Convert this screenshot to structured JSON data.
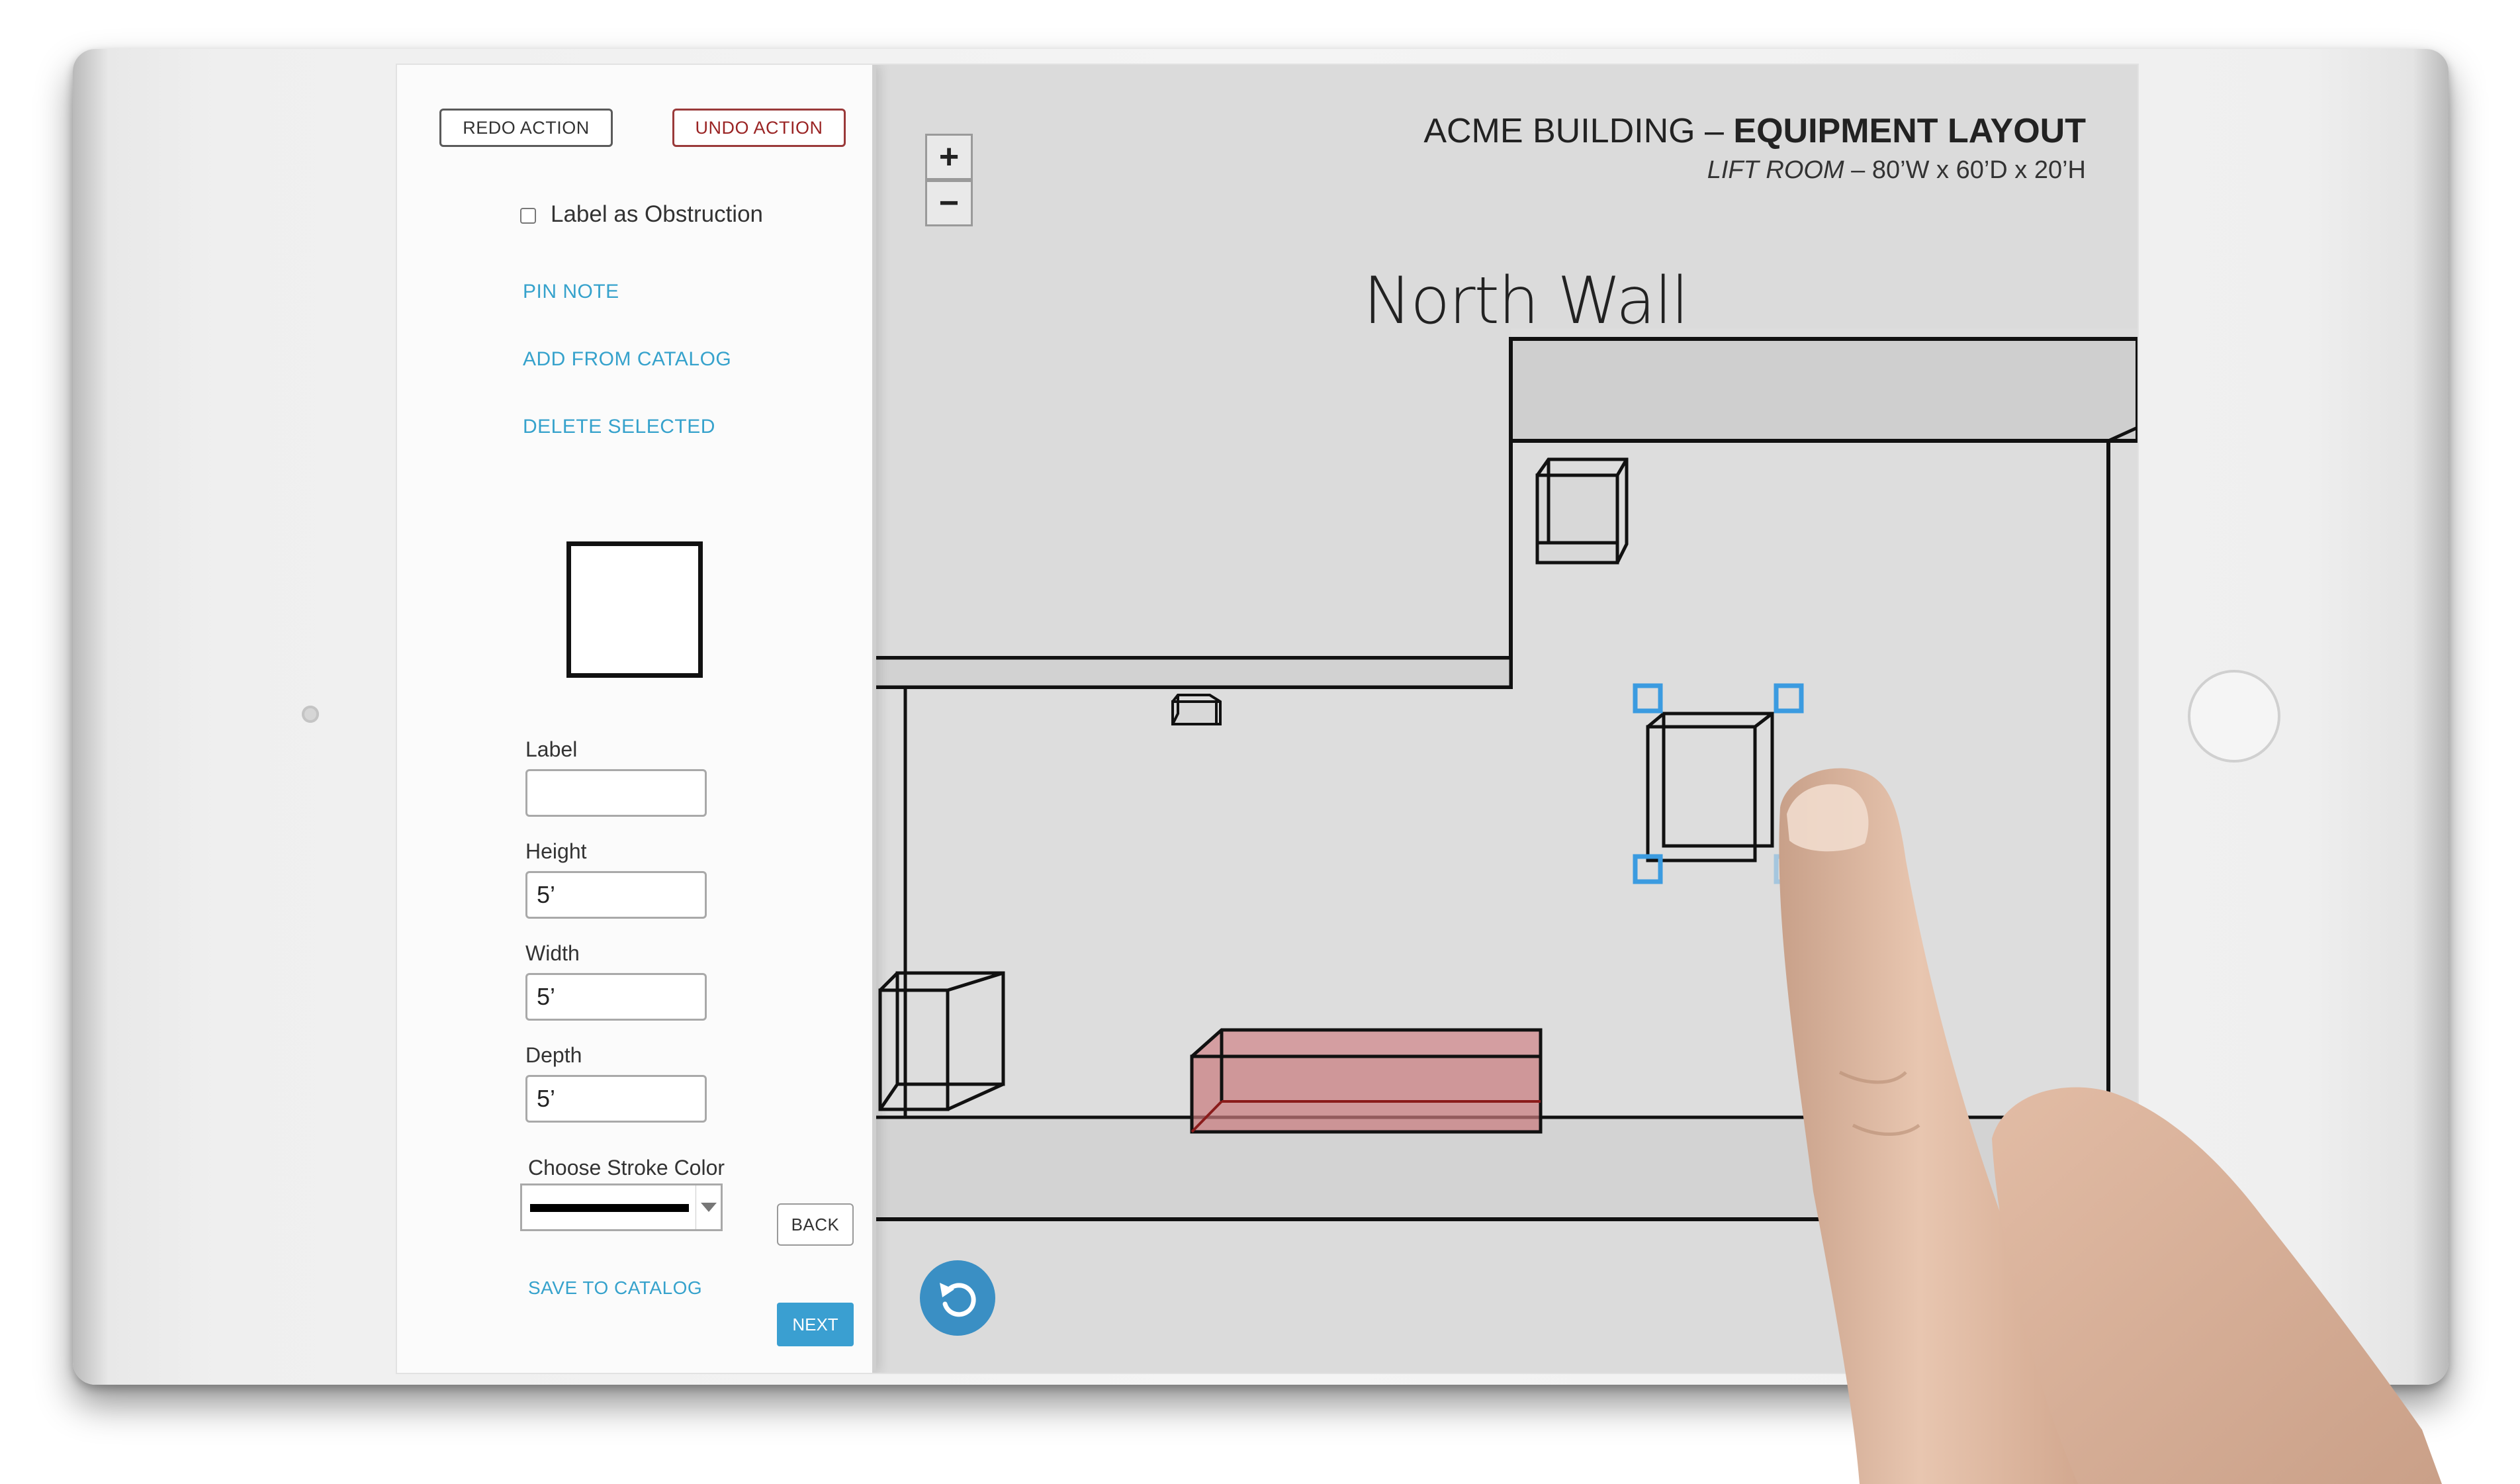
{
  "panel": {
    "redo_label": "REDO ACTION",
    "undo_label": "UNDO ACTION",
    "obstruction_label": "Label as Obstruction",
    "obstruction_checked": false,
    "pin_note": "PIN NOTE",
    "add_from_catalog": "ADD FROM CATALOG",
    "delete_selected": "DELETE SELECTED",
    "preview_shape": "square",
    "fields": {
      "label": {
        "title": "Label",
        "value": ""
      },
      "height": {
        "title": "Height",
        "value": "5’"
      },
      "width": {
        "title": "Width",
        "value": "5’"
      },
      "depth": {
        "title": "Depth",
        "value": "5’"
      }
    },
    "stroke_color_label": "Choose Stroke Color",
    "stroke_color": "#000000",
    "back_label": "BACK",
    "save_to_catalog": "SAVE TO CATALOG",
    "next_label": "NEXT"
  },
  "canvas": {
    "title_prefix": "ACME BUILDING – ",
    "title_bold": "EQUIPMENT LAYOUT",
    "subtitle_room": "LIFT ROOM",
    "subtitle_dims": " – 80’W x 60’D x 20’H",
    "wall_label": "North Wall",
    "zoom_in": "+",
    "zoom_out": "−",
    "selected_handle_color": "#3b9be0",
    "highlight_color": "#c9797c",
    "icons": [
      "undo-icon",
      "redo-icon",
      "selection-handle-icon"
    ]
  },
  "colors": {
    "accent": "#36a2cc",
    "next_button": "#3a9fd1",
    "undo_border": "#9a2424"
  }
}
